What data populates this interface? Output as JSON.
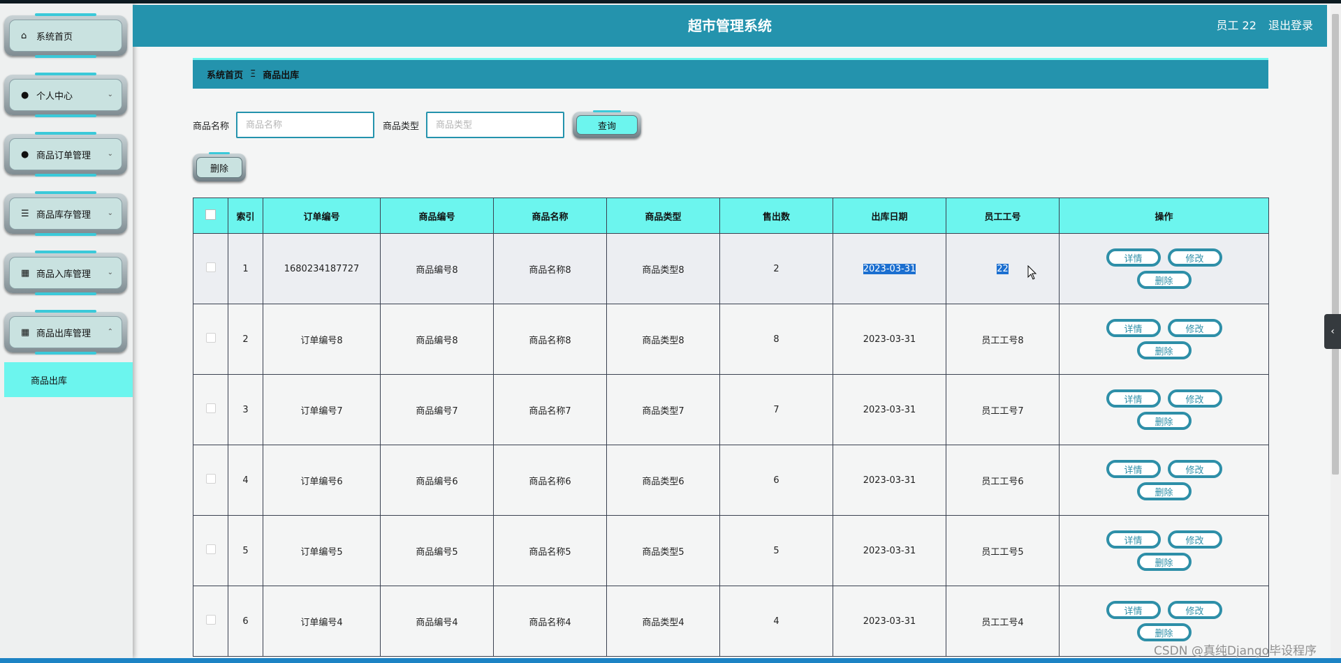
{
  "header": {
    "title": "超市管理系统",
    "user": "员工 22",
    "logout": "退出登录"
  },
  "sidebar": {
    "items": [
      {
        "label": "系统首页",
        "icon": "home-icon",
        "chev": ""
      },
      {
        "label": "个人中心",
        "icon": "user-icon",
        "chev": "⌄"
      },
      {
        "label": "商品订单管理",
        "icon": "user-icon",
        "chev": "⌄"
      },
      {
        "label": "商品库存管理",
        "icon": "list-icon",
        "chev": "⌄"
      },
      {
        "label": "商品入库管理",
        "icon": "grid-icon",
        "chev": "⌄"
      },
      {
        "label": "商品出库管理",
        "icon": "grid-icon",
        "chev": "⌃"
      }
    ],
    "submenu": "商品出库"
  },
  "breadcrumb": {
    "home": "系统首页",
    "sep": "Ξ",
    "current": "商品出库"
  },
  "search": {
    "name_label": "商品名称",
    "name_placeholder": "商品名称",
    "type_label": "商品类型",
    "type_placeholder": "商品类型",
    "button": "查询"
  },
  "delete_button": "删除",
  "table": {
    "columns": [
      "索引",
      "订单编号",
      "商品编号",
      "商品名称",
      "商品类型",
      "售出数",
      "出库日期",
      "员工工号",
      "操作"
    ],
    "rows": [
      [
        "1",
        "1680234187727",
        "商品编号8",
        "商品名称8",
        "商品类型8",
        "2",
        "2023-03-31",
        "22"
      ],
      [
        "2",
        "订单编号8",
        "商品编号8",
        "商品名称8",
        "商品类型8",
        "8",
        "2023-03-31",
        "员工工号8"
      ],
      [
        "3",
        "订单编号7",
        "商品编号7",
        "商品名称7",
        "商品类型7",
        "7",
        "2023-03-31",
        "员工工号7"
      ],
      [
        "4",
        "订单编号6",
        "商品编号6",
        "商品名称6",
        "商品类型6",
        "6",
        "2023-03-31",
        "员工工号6"
      ],
      [
        "5",
        "订单编号5",
        "商品编号5",
        "商品名称5",
        "商品类型5",
        "5",
        "2023-03-31",
        "员工工号5"
      ],
      [
        "6",
        "订单编号4",
        "商品编号4",
        "商品名称4",
        "商品类型4",
        "4",
        "2023-03-31",
        "员工工号4"
      ]
    ],
    "actions": {
      "detail": "详情",
      "edit": "修改",
      "delete": "删除"
    }
  },
  "watermark": "CSDN @真纯Django毕设程序",
  "side_tab": "‹",
  "colors": {
    "primary": "#2493ad",
    "accent": "#6cf5ee"
  }
}
